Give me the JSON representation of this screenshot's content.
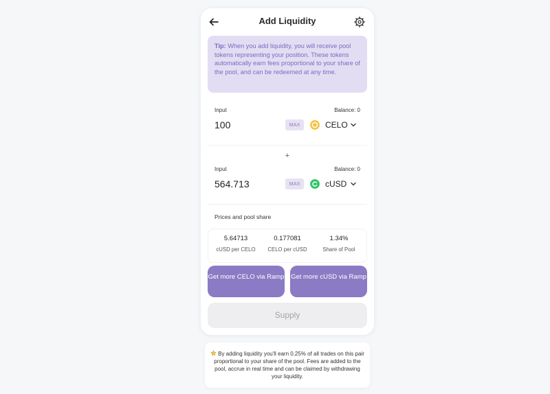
{
  "header": {
    "title": "Add Liquidity",
    "back_icon": "arrow-left-icon",
    "settings_icon": "gear-icon"
  },
  "tip": {
    "label": "Tip:",
    "text": " When you add liquidity, you will receive pool tokens representing your position. These tokens automatically earn fees proportional to your share of the pool, and can be redeemed at any time."
  },
  "inputs": [
    {
      "label": "Input",
      "balance": "Balance: 0",
      "value": "100",
      "max_label": "MAX",
      "token": "CELO",
      "token_color": "#f6c343"
    },
    {
      "label": "Input",
      "balance": "Balance: 0",
      "value": "564.713",
      "max_label": "MAX",
      "token": "cUSD",
      "token_color": "#35c46a"
    }
  ],
  "plus": "+",
  "prices": {
    "title": "Prices and pool share",
    "items": [
      {
        "value": "5.64713",
        "label": "cUSD per CELO"
      },
      {
        "value": "0.177081",
        "label": "CELO per cUSD"
      },
      {
        "value": "1.34%",
        "label": "Share of Pool"
      }
    ]
  },
  "buttons": {
    "ramp_celo": "Get more CELO via Ramp",
    "ramp_cusd": "Get more cUSD via Ramp",
    "supply": "Supply"
  },
  "note": {
    "icon": "star-icon",
    "text": "By adding liquidity you'll earn 0.25% of all trades on this pair proportional to your share of the pool. Fees are added to the pool, accrue in real time and can be claimed by withdrawing your liquidity."
  },
  "colors": {
    "accent": "#8a7bc4",
    "tip_bg": "#e3ddf3",
    "tip_text": "#7c6bbf"
  }
}
